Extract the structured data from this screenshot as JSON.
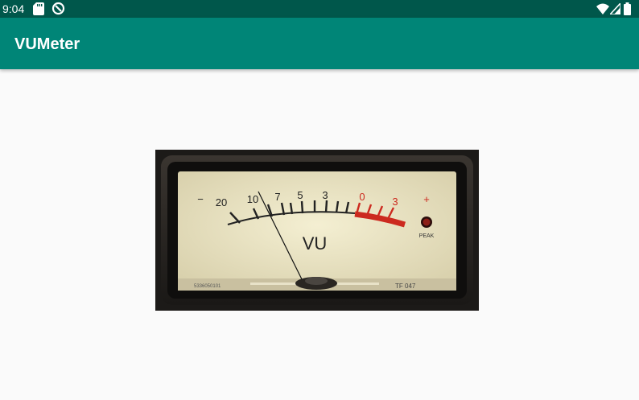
{
  "status_bar": {
    "time": "9:04",
    "left_icons": [
      "sd-card-icon",
      "sync-icon"
    ],
    "right_icons": [
      "wifi-icon",
      "signal-icon",
      "battery-icon"
    ],
    "background": "#00574b"
  },
  "app_bar": {
    "title": "VUMeter",
    "background": "#008577"
  },
  "meter": {
    "scale_labels": [
      "−",
      "20",
      "10",
      "7",
      "5",
      "3",
      "0",
      "3",
      "+"
    ],
    "label": "VU",
    "peak_label": "PEAK",
    "serial": "5336050101",
    "model": "TF 047",
    "face_color": "#eee8c6",
    "red_color": "#cc2a1f"
  }
}
